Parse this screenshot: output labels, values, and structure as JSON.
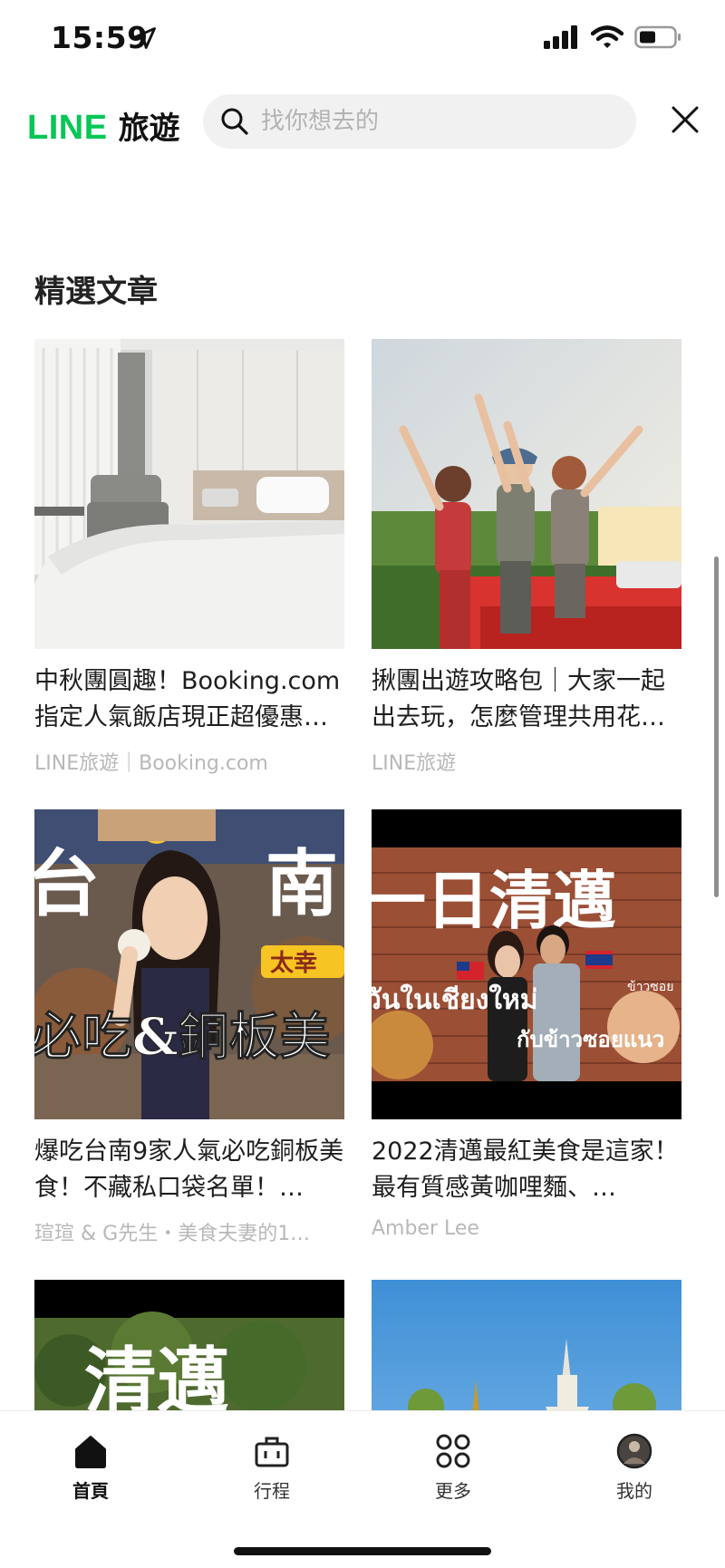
{
  "status": {
    "time": "15:59"
  },
  "header": {
    "logo_line": "LINE",
    "logo_travel": "旅遊",
    "search_placeholder": "找你想去的"
  },
  "section": {
    "title": "精選文章"
  },
  "articles": [
    {
      "title": "中秋團圓趣！Booking.com 指定人氣飯店現正超優惠…",
      "source": "LINE旅遊｜Booking.com"
    },
    {
      "title": "揪團出遊攻略包｜大家一起出去玩，怎麼管理共用花…",
      "source": "LINE旅遊"
    },
    {
      "title": "爆吃台南9家人氣必吃銅板美食！不藏私口袋名單！…",
      "source": "瑄瑄 & G先生・美食夫妻的1…"
    },
    {
      "title": "2022清邁最紅美食是這家！最有質感黃咖哩麵、…",
      "source": "Amber Lee"
    }
  ],
  "thumb_text": {
    "tainan_left": "台",
    "tainan_right": "南",
    "tainan_bottom": "必吃&銅板美",
    "tainan_tag": "太幸",
    "chiangmai_title": "一日清邁",
    "chiangmai_thai": "วันในเชียงใหม่",
    "chiangmai_thai2": "กับข้าวซอยแนว",
    "chiangmai_tag": "ข้าวซอย",
    "card5_title": "清邁"
  },
  "nav": [
    {
      "label": "首頁",
      "icon": "home-icon",
      "active": true
    },
    {
      "label": "行程",
      "icon": "suitcase-icon",
      "active": false
    },
    {
      "label": "更多",
      "icon": "more-grid-icon",
      "active": false
    },
    {
      "label": "我的",
      "icon": "avatar",
      "active": false
    }
  ],
  "colors": {
    "brand": "#06c755",
    "text": "#1e1e1e",
    "muted": "#b8b8b8"
  }
}
